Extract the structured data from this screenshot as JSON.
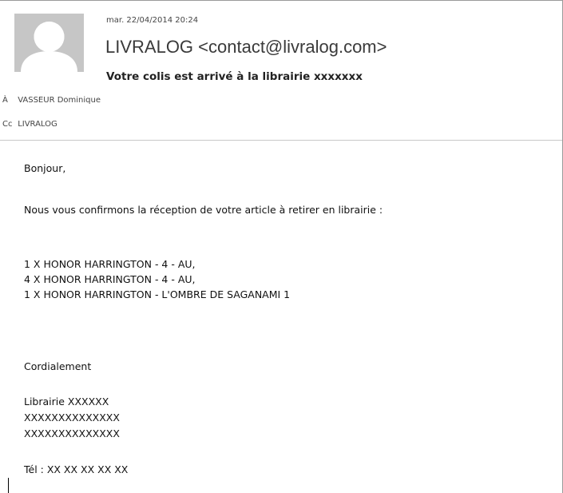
{
  "header": {
    "date": "mar. 22/04/2014 20:24",
    "sender": "LIVRALOG <contact@livralog.com>",
    "subject": "Votre colis est arrivé à la librairie xxxxxxx",
    "to_label": "À",
    "to_value": "VASSEUR Dominique",
    "cc_label": "Cc",
    "cc_value": "LIVRALOG"
  },
  "avatar_icon": "person-silhouette-icon",
  "colors": {
    "avatar_bg": "#c6c6c6",
    "avatar_fg": "#ffffff",
    "sender_text": "#3a3a3a",
    "divider": "#c8c8c8"
  },
  "body": {
    "greeting": "Bonjour,",
    "intro": "Nous vous confirmons la réception de votre article à retirer en librairie :",
    "items": [
      "1 X HONOR HARRINGTON - 4 - AU,",
      "4 X HONOR HARRINGTON - 4 - AU,",
      "1 X HONOR HARRINGTON - L'OMBRE DE SAGANAMI 1"
    ],
    "closing": "Cordialement",
    "signature": [
      "Librairie XXXXXX",
      "XXXXXXXXXXXXXX",
      "XXXXXXXXXXXXXX"
    ],
    "phone": "Tél : XX XX XX XX XX"
  }
}
